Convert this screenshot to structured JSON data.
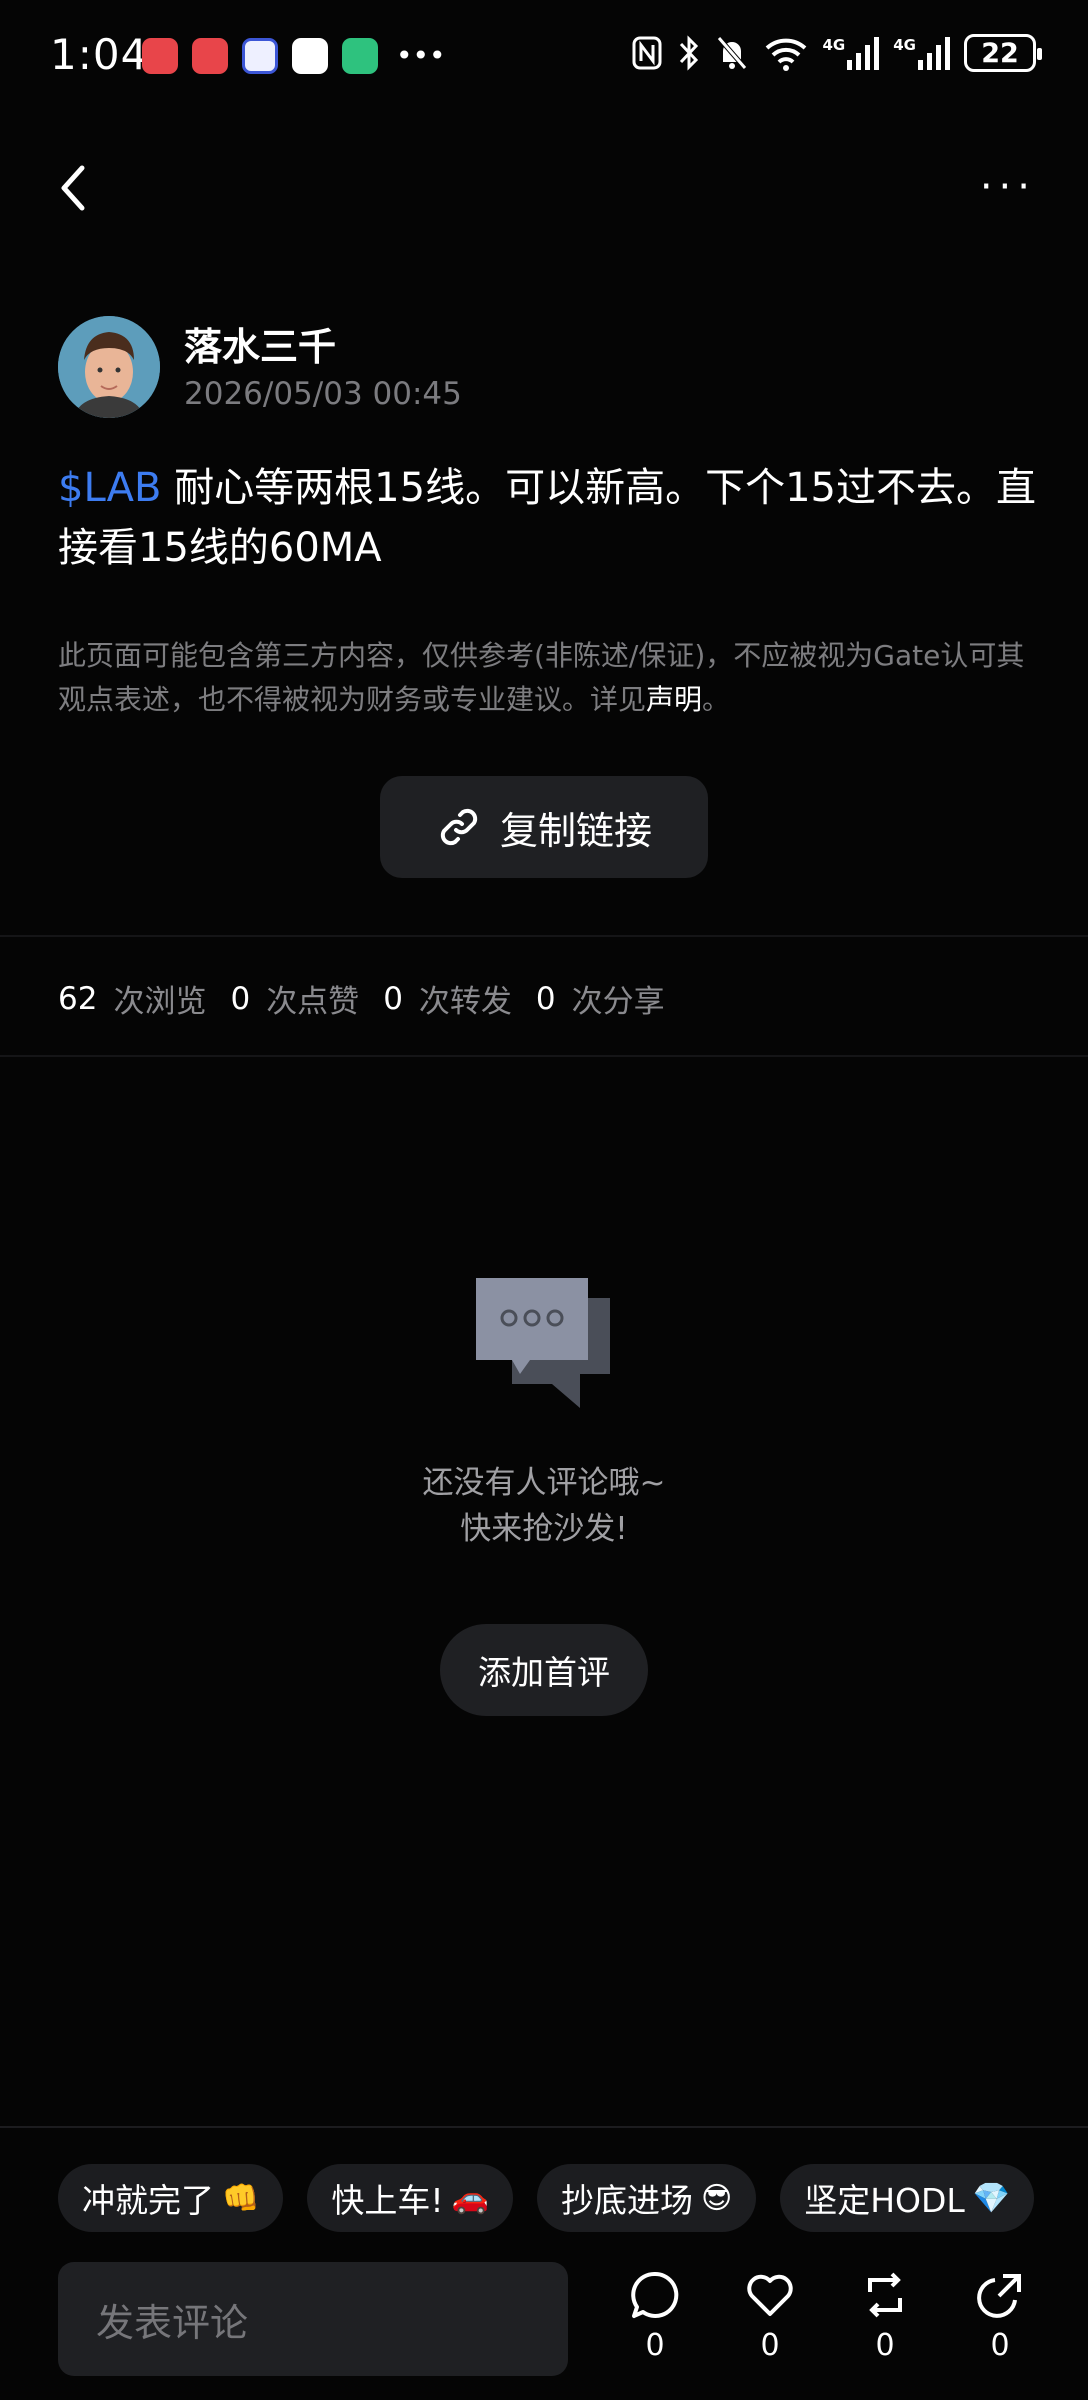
{
  "status_bar": {
    "time": "1:04",
    "network_1": "4G",
    "network_2": "4G",
    "battery": "22"
  },
  "post": {
    "author": "落水三千",
    "timestamp": "2026/05/03 00:45",
    "ticker": "$LAB",
    "content": " 耐心等两根15线。可以新高。下个15过不去。直接看15线的60MA"
  },
  "disclaimer": {
    "text": "此页面可能包含第三方内容，仅供参考(非陈述/保证)，不应被视为Gate认可其观点表述，也不得被视为财务或专业建议。详见",
    "link": "声明",
    "suffix": "。"
  },
  "copy_link": {
    "label": "复制链接"
  },
  "stats": {
    "views": "62",
    "views_label": "次浏览",
    "likes": "0",
    "likes_label": "次点赞",
    "reposts": "0",
    "reposts_label": "次转发",
    "shares": "0",
    "shares_label": "次分享"
  },
  "empty_state": {
    "line1": "还没有人评论哦~",
    "line2": "快来抢沙发!",
    "button": "添加首评"
  },
  "quick_replies": [
    {
      "label": "冲就完了",
      "emoji": "👊"
    },
    {
      "label": "快上车!",
      "emoji": "🚗"
    },
    {
      "label": "抄底进场",
      "emoji": "😎"
    },
    {
      "label": "坚定HODL",
      "emoji": "💎"
    }
  ],
  "comment_input": {
    "placeholder": "发表评论"
  },
  "actions": {
    "comment_count": "0",
    "like_count": "0",
    "repost_count": "0",
    "share_count": "0"
  },
  "colors": {
    "background": "#050505",
    "accent_ticker": "#3d7cf0",
    "button_bg": "#1f2023"
  }
}
